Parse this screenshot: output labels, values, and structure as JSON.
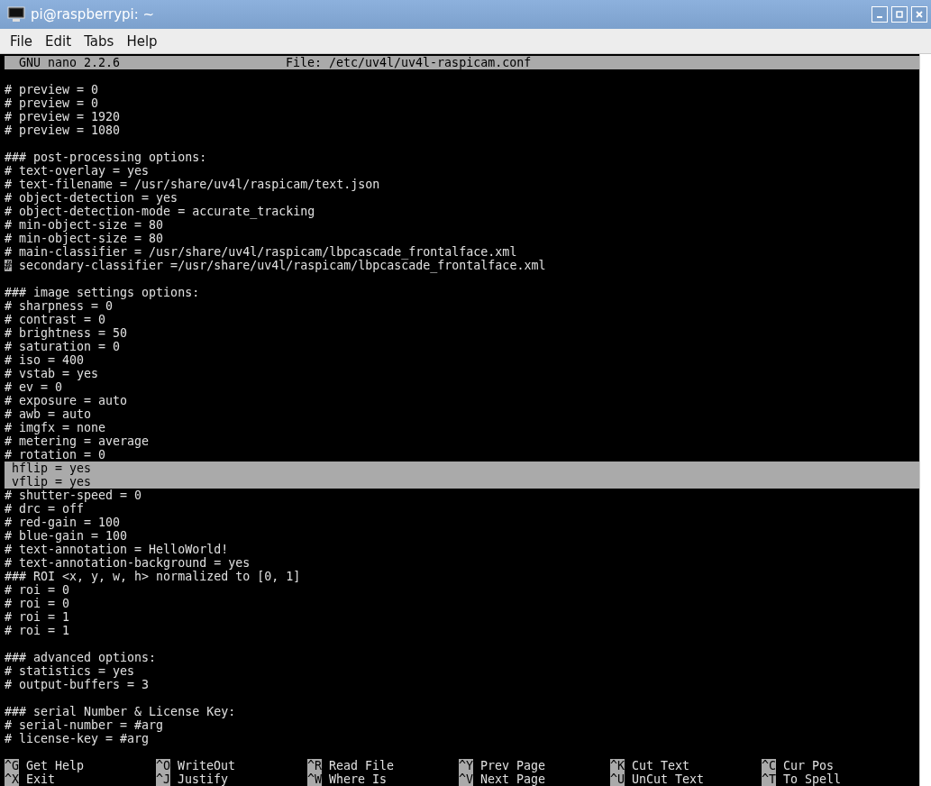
{
  "window": {
    "title": "pi@raspberrypi: ~"
  },
  "menu": [
    "File",
    "Edit",
    "Tabs",
    "Help"
  ],
  "nano_header": {
    "version": "GNU nano 2.2.6",
    "file": "File: /etc/uv4l/uv4l-raspicam.conf"
  },
  "lines": [
    {
      "kind": "text",
      "text": "# preview = 0",
      "selected": false,
      "cursor": false
    },
    {
      "kind": "text",
      "text": "# preview = 0",
      "selected": false,
      "cursor": false
    },
    {
      "kind": "text",
      "text": "# preview = 1920",
      "selected": false,
      "cursor": false
    },
    {
      "kind": "text",
      "text": "# preview = 1080",
      "selected": false,
      "cursor": false
    },
    {
      "kind": "blank"
    },
    {
      "kind": "text",
      "text": "### post-processing options:",
      "selected": false,
      "cursor": false
    },
    {
      "kind": "text",
      "text": "# text-overlay = yes",
      "selected": false,
      "cursor": false
    },
    {
      "kind": "text",
      "text": "# text-filename = /usr/share/uv4l/raspicam/text.json",
      "selected": false,
      "cursor": false
    },
    {
      "kind": "text",
      "text": "# object-detection = yes",
      "selected": false,
      "cursor": false
    },
    {
      "kind": "text",
      "text": "# object-detection-mode = accurate_tracking",
      "selected": false,
      "cursor": false
    },
    {
      "kind": "text",
      "text": "# min-object-size = 80",
      "selected": false,
      "cursor": false
    },
    {
      "kind": "text",
      "text": "# min-object-size = 80",
      "selected": false,
      "cursor": false
    },
    {
      "kind": "text",
      "text": "# main-classifier = /usr/share/uv4l/raspicam/lbpcascade_frontalface.xml",
      "selected": false,
      "cursor": false
    },
    {
      "kind": "text",
      "text": "# secondary-classifier =/usr/share/uv4l/raspicam/lbpcascade_frontalface.xml",
      "selected": false,
      "cursor": true
    },
    {
      "kind": "blank"
    },
    {
      "kind": "text",
      "text": "### image settings options:",
      "selected": false,
      "cursor": false
    },
    {
      "kind": "text",
      "text": "# sharpness = 0",
      "selected": false,
      "cursor": false
    },
    {
      "kind": "text",
      "text": "# contrast = 0",
      "selected": false,
      "cursor": false
    },
    {
      "kind": "text",
      "text": "# brightness = 50",
      "selected": false,
      "cursor": false
    },
    {
      "kind": "text",
      "text": "# saturation = 0",
      "selected": false,
      "cursor": false
    },
    {
      "kind": "text",
      "text": "# iso = 400",
      "selected": false,
      "cursor": false
    },
    {
      "kind": "text",
      "text": "# vstab = yes",
      "selected": false,
      "cursor": false
    },
    {
      "kind": "text",
      "text": "# ev = 0",
      "selected": false,
      "cursor": false
    },
    {
      "kind": "text",
      "text": "# exposure = auto",
      "selected": false,
      "cursor": false
    },
    {
      "kind": "text",
      "text": "# awb = auto",
      "selected": false,
      "cursor": false
    },
    {
      "kind": "text",
      "text": "# imgfx = none",
      "selected": false,
      "cursor": false
    },
    {
      "kind": "text",
      "text": "# metering = average",
      "selected": false,
      "cursor": false
    },
    {
      "kind": "text",
      "text": "# rotation = 0",
      "selected": false,
      "cursor": false
    },
    {
      "kind": "text",
      "text": " hflip = yes",
      "selected": true,
      "cursor": false
    },
    {
      "kind": "text",
      "text": " vflip = yes",
      "selected": true,
      "cursor": false
    },
    {
      "kind": "text",
      "text": "# shutter-speed = 0",
      "selected": false,
      "cursor": false
    },
    {
      "kind": "text",
      "text": "# drc = off",
      "selected": false,
      "cursor": false
    },
    {
      "kind": "text",
      "text": "# red-gain = 100",
      "selected": false,
      "cursor": false
    },
    {
      "kind": "text",
      "text": "# blue-gain = 100",
      "selected": false,
      "cursor": false
    },
    {
      "kind": "text",
      "text": "# text-annotation = HelloWorld!",
      "selected": false,
      "cursor": false
    },
    {
      "kind": "text",
      "text": "# text-annotation-background = yes",
      "selected": false,
      "cursor": false
    },
    {
      "kind": "text",
      "text": "### ROI <x, y, w, h> normalized to [0, 1]",
      "selected": false,
      "cursor": false
    },
    {
      "kind": "text",
      "text": "# roi = 0",
      "selected": false,
      "cursor": false
    },
    {
      "kind": "text",
      "text": "# roi = 0",
      "selected": false,
      "cursor": false
    },
    {
      "kind": "text",
      "text": "# roi = 1",
      "selected": false,
      "cursor": false
    },
    {
      "kind": "text",
      "text": "# roi = 1",
      "selected": false,
      "cursor": false
    },
    {
      "kind": "blank"
    },
    {
      "kind": "text",
      "text": "### advanced options:",
      "selected": false,
      "cursor": false
    },
    {
      "kind": "text",
      "text": "# statistics = yes",
      "selected": false,
      "cursor": false
    },
    {
      "kind": "text",
      "text": "# output-buffers = 3",
      "selected": false,
      "cursor": false
    },
    {
      "kind": "blank"
    },
    {
      "kind": "text",
      "text": "### serial Number & License Key:",
      "selected": false,
      "cursor": false
    },
    {
      "kind": "text",
      "text": "# serial-number = #arg",
      "selected": false,
      "cursor": false
    },
    {
      "kind": "text",
      "text": "# license-key = #arg",
      "selected": false,
      "cursor": false
    }
  ],
  "shortcuts": [
    [
      {
        "key": "^G",
        "label": "Get Help"
      },
      {
        "key": "^O",
        "label": "WriteOut"
      },
      {
        "key": "^R",
        "label": "Read File"
      },
      {
        "key": "^Y",
        "label": "Prev Page"
      },
      {
        "key": "^K",
        "label": "Cut Text"
      },
      {
        "key": "^C",
        "label": "Cur Pos"
      }
    ],
    [
      {
        "key": "^X",
        "label": "Exit"
      },
      {
        "key": "^J",
        "label": "Justify"
      },
      {
        "key": "^W",
        "label": "Where Is"
      },
      {
        "key": "^V",
        "label": "Next Page"
      },
      {
        "key": "^U",
        "label": "UnCut Text"
      },
      {
        "key": "^T",
        "label": "To Spell"
      }
    ]
  ]
}
